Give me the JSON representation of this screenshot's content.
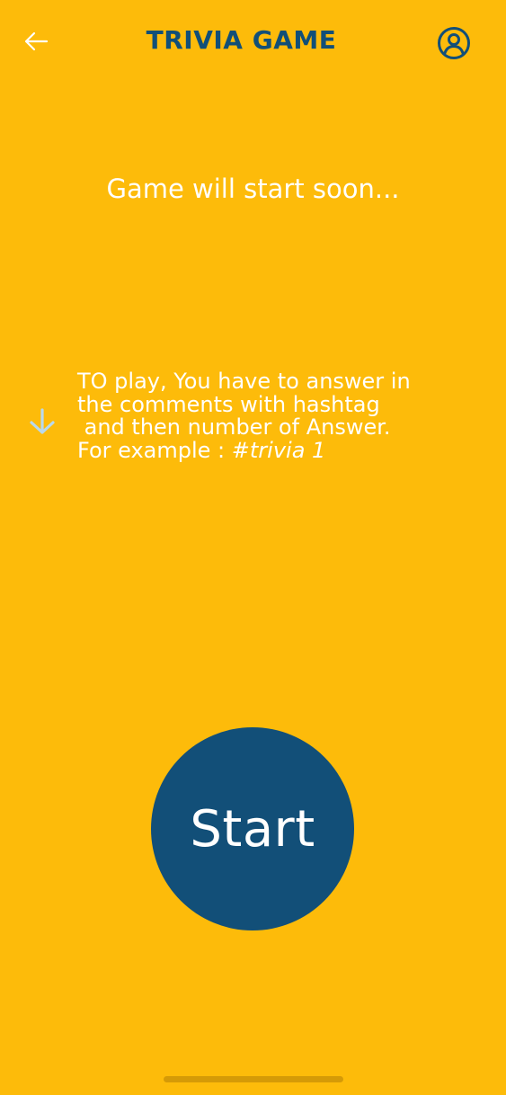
{
  "header": {
    "title": "TRIVIA GAME",
    "back_icon": "arrow-left-icon",
    "profile_icon": "user-circle-icon"
  },
  "status": {
    "text": "Game will start soon..."
  },
  "instructions": {
    "icon": "arrow-down-icon",
    "line1": "TO play, You have to answer in",
    "line2": "the comments with hashtag",
    "line3": " and then number of Answer.",
    "line4_prefix": "For example : ",
    "line4_example": "#trivia 1"
  },
  "start_button": {
    "label": "Start"
  },
  "colors": {
    "background": "#FDBB0A",
    "title": "#124F78",
    "button": "#124F78",
    "text": "#FFFFFF",
    "down_arrow": "#B9D9EC"
  }
}
